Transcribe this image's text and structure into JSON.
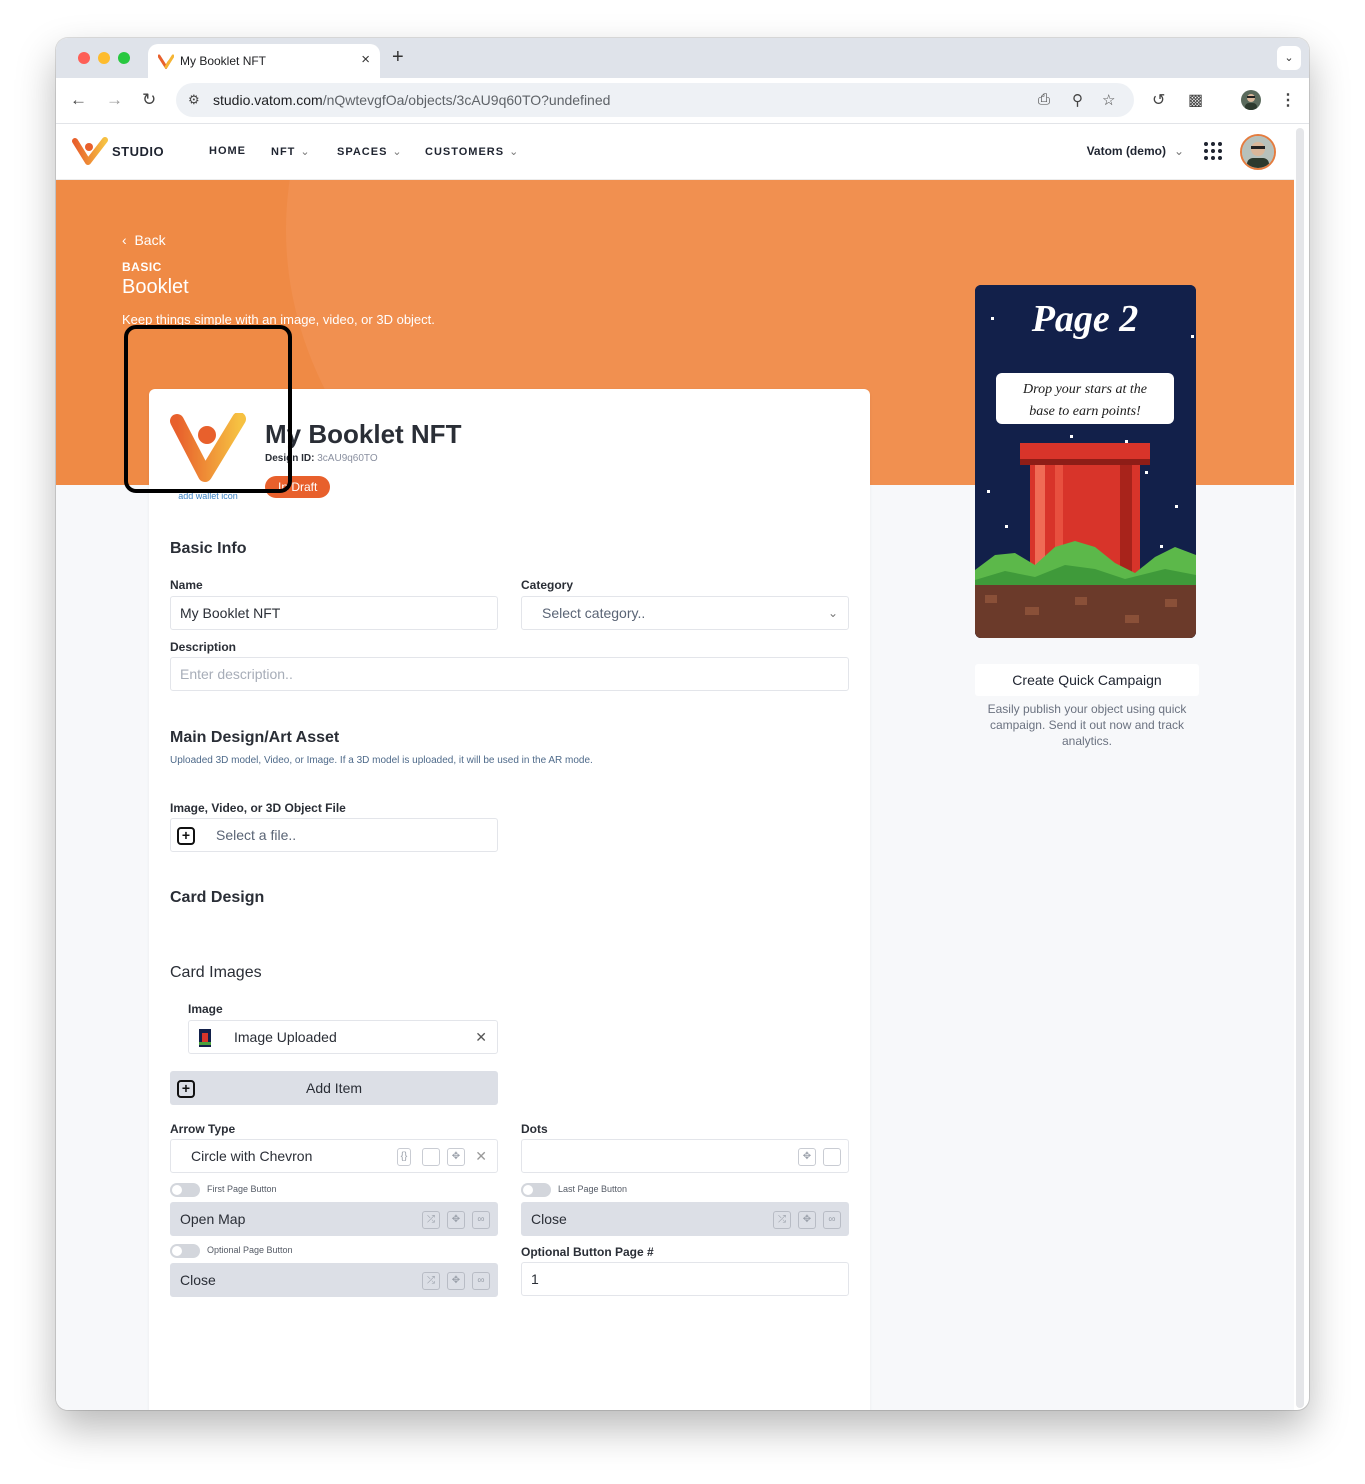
{
  "browser": {
    "tab_title": "My Booklet NFT",
    "tab_close": "×",
    "new_tab": "+",
    "tab_menu": "⌄",
    "url_host": "studio.vatom.com",
    "url_path": "/nQwtevgfOa/objects/3cAU9q60TO?undefined"
  },
  "appnav": {
    "logo_text": "STUDIO",
    "links": [
      "HOME",
      "NFT",
      "SPACES",
      "CUSTOMERS"
    ],
    "org": "Vatom (demo)"
  },
  "hero": {
    "back": "Back",
    "kicker": "BASIC",
    "title": "Booklet",
    "subtitle": "Keep things simple with an image, video, or 3D object."
  },
  "object": {
    "wallet_label": "add wallet icon",
    "title": "My Booklet NFT",
    "design_id_label": "Design ID:",
    "design_id": "3cAU9q60TO",
    "status": "In Draft"
  },
  "basic_info": {
    "heading": "Basic Info",
    "name_label": "Name",
    "name_value": "My Booklet NFT",
    "category_label": "Category",
    "category_placeholder": "Select category..",
    "description_label": "Description",
    "description_placeholder": "Enter description.."
  },
  "asset": {
    "heading": "Main Design/Art Asset",
    "subtext": "Uploaded 3D model, Video, or Image. If a 3D model is uploaded, it will be used in the AR mode.",
    "file_label": "Image, Video, or 3D Object File",
    "file_placeholder": "Select a file.."
  },
  "card_design": {
    "heading": "Card Design",
    "images_heading": "Card Images",
    "image_label": "Image",
    "image_value": "Image Uploaded",
    "add_item": "Add Item",
    "arrow_type_label": "Arrow Type",
    "arrow_type_value": "Circle with Chevron",
    "dots_label": "Dots",
    "first_page_label": "First Page Button",
    "first_page_value": "Open Map",
    "last_page_label": "Last Page Button",
    "last_page_value": "Close",
    "optional_page_label": "Optional Page Button",
    "optional_page_value": "Close",
    "optional_page_num_label": "Optional Button Page #",
    "optional_page_num_value": "1"
  },
  "preview": {
    "title": "Page 2",
    "caption_line1": "Drop your stars at the",
    "caption_line2": "base to earn points!"
  },
  "quick_campaign": {
    "button": "Create Quick Campaign",
    "description": "Easily publish your object using quick campaign. Send it out now and track analytics."
  },
  "colors": {
    "accent": "#ef8a45",
    "badge": "#e8602c",
    "preview_bg": "#12204a"
  }
}
